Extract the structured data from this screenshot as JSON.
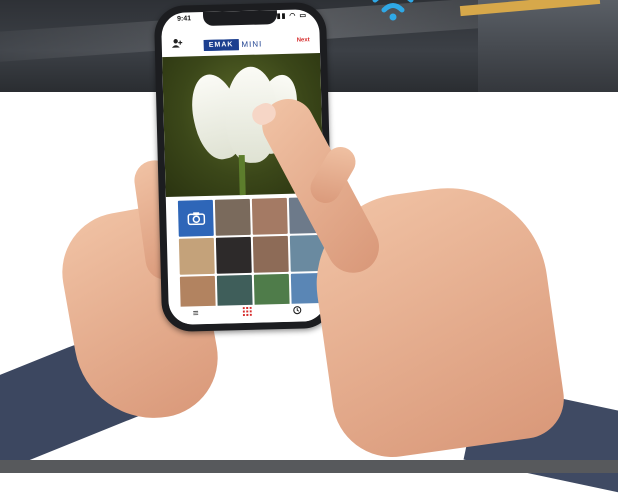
{
  "status_bar": {
    "time": "9:41"
  },
  "app_bar": {
    "brand_box": "EMAK",
    "brand_suffix": "MINI",
    "next_label": "Next",
    "add_user_icon": "add-user-icon"
  },
  "tab_bar": {
    "menu_icon": "menu-icon",
    "grid_icon": "grid-icon",
    "history_icon": "history-icon"
  },
  "colors": {
    "brand_blue": "#1c3f8f",
    "accent_red": "#d62b2b",
    "camera_tile": "#2e66b8"
  },
  "gallery": {
    "cells": [
      {
        "kind": "camera",
        "color": "#2e66b8"
      },
      {
        "kind": "photo",
        "color": "#7a6a5c"
      },
      {
        "kind": "photo",
        "color": "#a47a64"
      },
      {
        "kind": "photo",
        "color": "#6d7a8a"
      },
      {
        "kind": "photo",
        "color": "#c4a27a"
      },
      {
        "kind": "photo",
        "color": "#2d2a2a"
      },
      {
        "kind": "photo",
        "color": "#8d6b57"
      },
      {
        "kind": "photo",
        "color": "#6a8aa0"
      },
      {
        "kind": "photo",
        "color": "#b28360"
      },
      {
        "kind": "photo",
        "color": "#3f5e5a"
      },
      {
        "kind": "photo",
        "color": "#4f7c4a"
      },
      {
        "kind": "photo",
        "color": "#5a86b5"
      }
    ]
  }
}
